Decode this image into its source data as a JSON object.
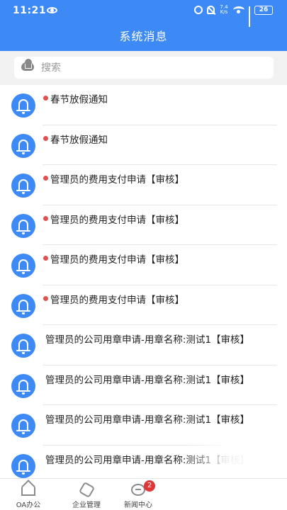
{
  "status_bar": {
    "time": "11:21",
    "net_speed_value": "7.4",
    "net_speed_unit": "K/s",
    "battery": "26"
  },
  "header": {
    "title": "系统消息"
  },
  "search": {
    "placeholder": "搜索",
    "value": ""
  },
  "messages": [
    {
      "title": "春节放假通知",
      "unread": true
    },
    {
      "title": "春节放假通知",
      "unread": true
    },
    {
      "title": "管理员的费用支付申请【审核】",
      "unread": true
    },
    {
      "title": "管理员的费用支付申请【审核】",
      "unread": true
    },
    {
      "title": "管理员的费用支付申请【审核】",
      "unread": true
    },
    {
      "title": "管理员的费用支付申请【审核】",
      "unread": true
    },
    {
      "title": "管理员的公司用章申请-用章名称:测试1【审核】",
      "unread": false
    },
    {
      "title": "管理员的公司用章申请-用章名称:测试1【审核】",
      "unread": false
    },
    {
      "title": "管理员的公司用章申请-用章名称:测试1【审核】",
      "unread": false
    },
    {
      "title": "管理员的公司用章申请-用章名称:测试1【审核】",
      "unread": false
    }
  ],
  "tabbar": {
    "tabs": [
      {
        "label": "OA办公",
        "icon": "home-icon"
      },
      {
        "label": "企业管理",
        "icon": "cube-icon"
      },
      {
        "label": "新闻中心",
        "icon": "chat-icon",
        "badge": "2"
      }
    ]
  },
  "colors": {
    "primary": "#3d8af7",
    "unread_dot": "#e14f4f",
    "badge": "#e0363a"
  }
}
